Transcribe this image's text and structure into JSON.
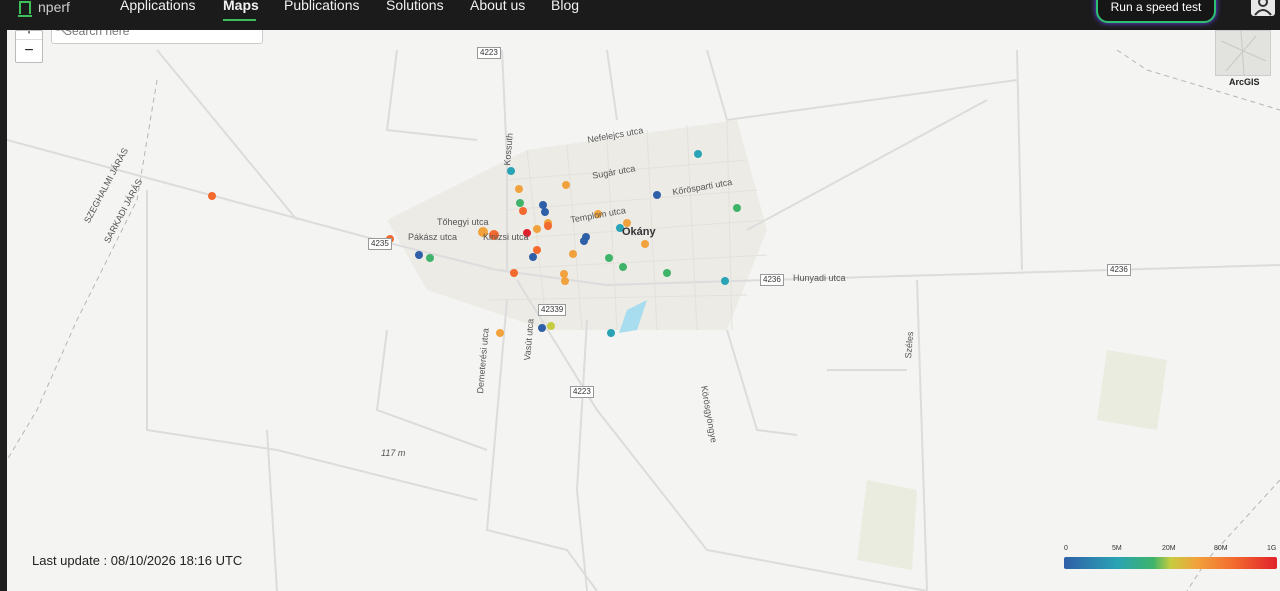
{
  "header": {
    "logo_text": "nperf",
    "nav": [
      "Applications",
      "Maps",
      "Publications",
      "Solutions",
      "About us",
      "Blog"
    ],
    "active_nav": "Maps",
    "speed_test_label": "Run a speed test",
    "accent_color": "#3fbf5a"
  },
  "map": {
    "search_placeholder": "Search here",
    "zoom_in": "+",
    "zoom_out": "−",
    "basemap_label": "ArcGIS",
    "town_name": "Okány",
    "street_labels": [
      "Nefelejcs utca",
      "Sugár utca",
      "Kőrösparti utca",
      "Templom utca",
      "Tőhegyi utca",
      "Pákász utca",
      "Kinizsi utca",
      "Hunyadi utca",
      "Vasút utca",
      "Demeterési utca",
      "Körösgyöngye",
      "Széles",
      "Kossuth"
    ],
    "district_labels": [
      "SZEGHALMI JÁRÁS",
      "SARKADI JÁRÁS"
    ],
    "elevation_label": "117 m",
    "road_shields": [
      "4223",
      "4235",
      "4236",
      "4236",
      "42339",
      "4223"
    ],
    "last_update_text": "Last update : 08/10/2026 18:16 UTC",
    "legend": {
      "labels": [
        "0",
        "5M",
        "20M",
        "80M",
        "1G"
      ],
      "colors": [
        "#2f5fa7",
        "#2aa3b4",
        "#3fb36a",
        "#c6cc3f",
        "#f1a23c",
        "#f26a2e",
        "#e0212c"
      ]
    }
  }
}
